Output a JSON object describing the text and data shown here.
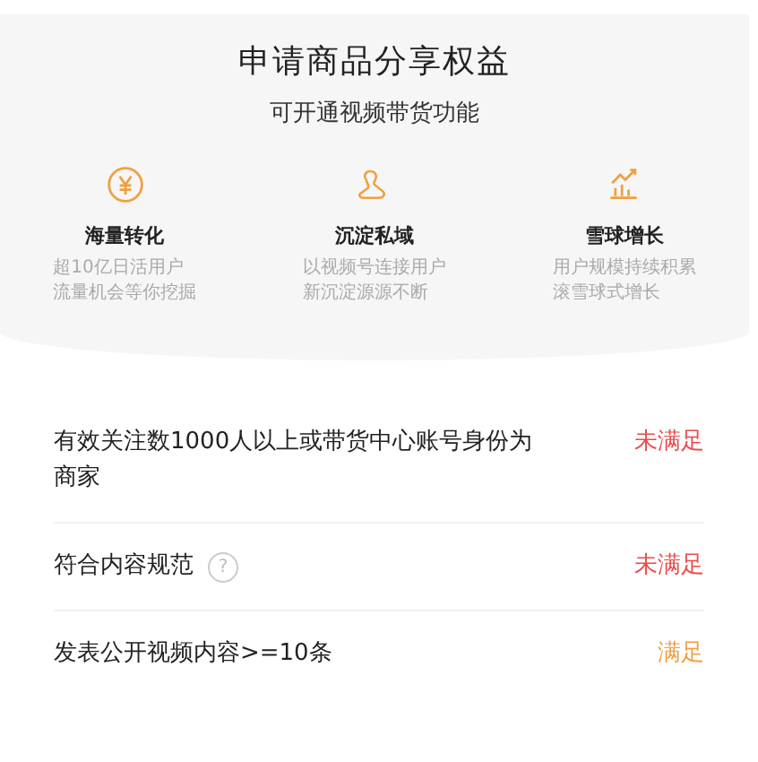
{
  "header": {
    "title": "申请商品分享权益",
    "subtitle": "可开通视频带货功能"
  },
  "benefits": [
    {
      "kind": "yuan",
      "title": "海量转化",
      "lines": [
        "超10亿日活用户",
        "流量机会等你挖掘"
      ]
    },
    {
      "kind": "people",
      "title": "沉淀私域",
      "lines": [
        "以视频号连接用户",
        "新沉淀源源不断"
      ]
    },
    {
      "kind": "growth",
      "title": "雪球增长",
      "lines": [
        "用户规模持续积累",
        "滚雪球式增长"
      ]
    }
  ],
  "requirements": [
    {
      "text": "有效关注数1000人以上或带货中心账号身份为商家",
      "status": "未满足",
      "met": false,
      "help": false
    },
    {
      "text": "符合内容规范",
      "status": "未满足",
      "met": false,
      "help": true,
      "help_icon": "?"
    },
    {
      "text": "发表公开视频内容>=10条",
      "status": "满足",
      "met": true,
      "help": false
    }
  ]
}
